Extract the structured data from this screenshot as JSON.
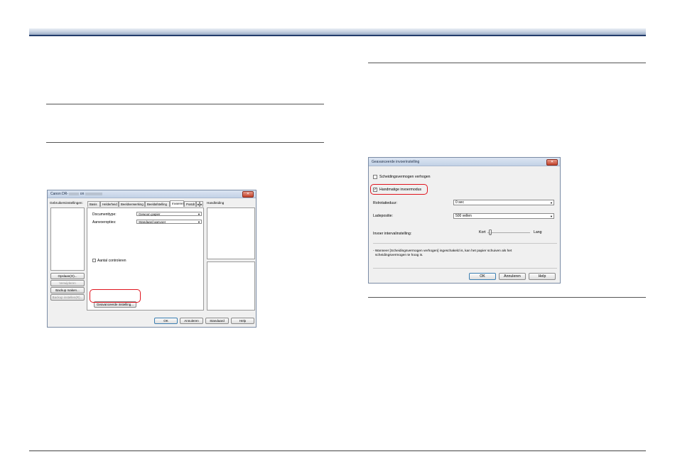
{
  "dialog_main": {
    "title": "Canon DR-",
    "title_suffix": "on",
    "user_settings_label": "Gebruikersinstellingen:",
    "options_button": "Opslaan(O)...",
    "delete_button": "Verwijderen",
    "backup_button": "Backup maken...",
    "restore_button": "Backup instellen(R)...",
    "tabs": [
      "Basis",
      "Helderheid",
      "Beeldverwerking",
      "Beeldafstelling",
      "Invoeren",
      "Postdr"
    ],
    "tab_scroll_left": "◂",
    "tab_scroll_right": "▸",
    "document_type_label": "Documenttype:",
    "document_type_value": "Gewoon papier",
    "feed_option_label": "Aanvoeropties:",
    "feed_option_value": "Standaard aanvoer",
    "count_only_label": "Aantal controleren",
    "advanced_button": "Geavanceerde instelling...",
    "handling_label": "Handleiding",
    "ok": "OK",
    "cancel": "Annuleren",
    "default": "Standaard",
    "help": "Help"
  },
  "dialog_adv": {
    "title": "Geavanceerde invoerinstelling",
    "close": "✕",
    "separation_label": "Scheidingsvermogen verhogen",
    "manual_feed_label": "Handmatige invoermodus",
    "manual_feed_checked": "✓",
    "roll_time_label": "Rolrotatieduur:",
    "roll_time_value": "0 sec",
    "tray_label": "Ladepositie:",
    "tray_value": "500 vellen",
    "interval_label": "Invoer intervalinstelling:",
    "slider_min": "Kort",
    "slider_max": "Lang",
    "note_line1": "- Wanneer [Scheidingsvermogen verhogen] ingeschakeld is, kan het papier schuiven als het",
    "note_line2": "scheidingsvermogen te hoog is.",
    "ok": "OK",
    "cancel": "Annuleren",
    "help": "Help"
  },
  "colors": {
    "header_bar": "#233d6b",
    "highlight": "#e0141e"
  }
}
